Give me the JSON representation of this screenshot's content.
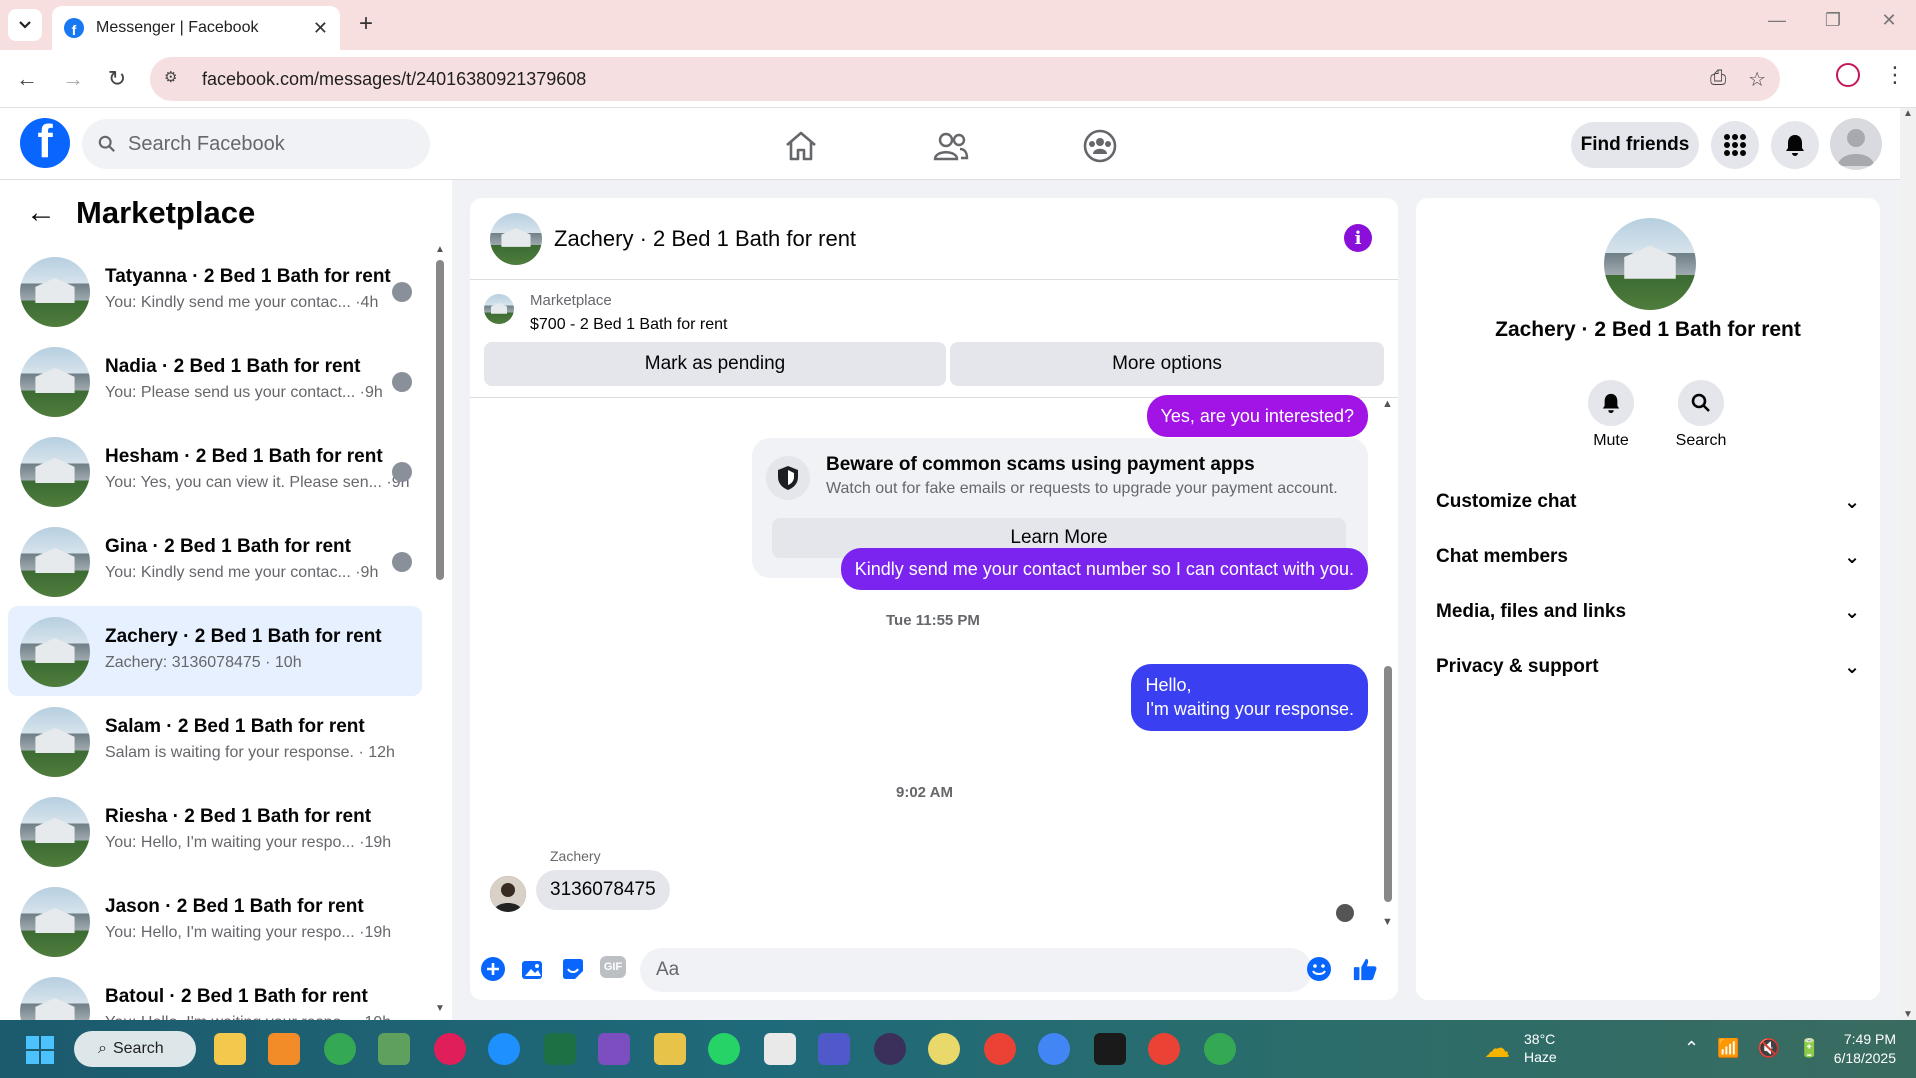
{
  "browser": {
    "tab_title": "Messenger | Facebook",
    "new_tab": "+",
    "close": "✕",
    "url": "facebook.com/messages/t/24016380921379608"
  },
  "fb": {
    "search_placeholder": "Search Facebook",
    "find_friends": "Find friends"
  },
  "left": {
    "title": "Marketplace",
    "conversations": [
      {
        "name": "Tatyanna · 2 Bed 1 Bath for rent",
        "snippet": "You: Kindly send me your contac... ·4h",
        "active": false
      },
      {
        "name": "Nadia · 2 Bed 1 Bath for rent",
        "snippet": "You: Please send us your contact... ·9h",
        "active": false
      },
      {
        "name": "Hesham · 2 Bed 1 Bath for rent",
        "snippet": "You: Yes, you can view it. Please sen... ·9h",
        "active": false
      },
      {
        "name": "Gina · 2 Bed 1 Bath for rent",
        "snippet": "You: Kindly send me your contac... ·9h",
        "active": false
      },
      {
        "name": "Zachery · 2 Bed 1 Bath for rent",
        "snippet": "Zachery: 3136078475 · 10h",
        "active": true
      },
      {
        "name": "Salam · 2 Bed 1 Bath for rent",
        "snippet": "Salam is waiting for your response. · 12h",
        "active": false
      },
      {
        "name": "Riesha · 2 Bed 1 Bath for rent",
        "snippet": "You: Hello, I'm waiting your respo... ·19h",
        "active": false
      },
      {
        "name": "Jason · 2 Bed 1 Bath for rent",
        "snippet": "You: Hello, I'm waiting your respo... ·19h",
        "active": false
      },
      {
        "name": "Batoul · 2 Bed 1 Bath for rent",
        "snippet": "You: Hello, I'm waiting your respo... ·19h",
        "active": false
      }
    ]
  },
  "chat": {
    "title": "Zachery · 2 Bed 1 Bath for rent",
    "marketplace_label": "Marketplace",
    "listing": "$700 - 2 Bed 1 Bath for rent",
    "mark_pending": "Mark as pending",
    "more_options": "More options",
    "msg1": "Yes, are you interested?",
    "scam_title": "Beware of common scams using payment apps",
    "scam_sub": "Watch out for fake emails or requests to upgrade your payment account.",
    "learn_more": "Learn More",
    "msg2": "Kindly send me your contact number so I can contact with you.",
    "time1": "Tue 11:55 PM",
    "msg3_line1": "Hello,",
    "msg3_line2": "I'm waiting your response.",
    "time2": "9:02 AM",
    "sender": "Zachery",
    "incoming": "3136078475",
    "composer_placeholder": "Aa",
    "gif": "GIF"
  },
  "info": {
    "name": "Zachery · 2 Bed 1 Bath for rent",
    "mute": "Mute",
    "search": "Search",
    "rows": [
      "Customize chat",
      "Chat members",
      "Media, files and links",
      "Privacy & support"
    ]
  },
  "taskbar": {
    "search": "Search",
    "temp": "38°C",
    "weather": "Haze",
    "time": "7:49 PM",
    "date": "6/18/2025"
  },
  "colors": {
    "fb_blue": "#0866ff",
    "msg_purple": "#a213e6",
    "msg_violet": "#7b24f0",
    "msg_blue": "#3b3ff2"
  }
}
